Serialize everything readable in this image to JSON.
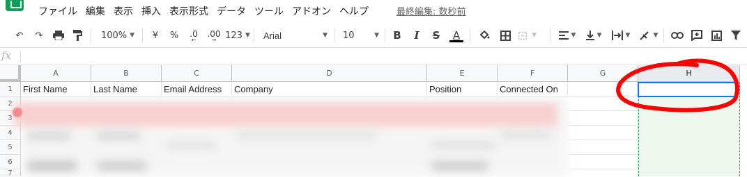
{
  "menubar": {
    "items": [
      "ファイル",
      "編集",
      "表示",
      "挿入",
      "表示形式",
      "データ",
      "ツール",
      "アドオン",
      "ヘルプ"
    ],
    "last_edit": "最終編集: 数秒前"
  },
  "toolbar": {
    "zoom": "100%",
    "currency": "¥",
    "percent": "%",
    "decrease_decimal": ".0",
    "increase_decimal": ".00",
    "number_format": "123",
    "font": "Arial",
    "font_size": "10",
    "bold": "B",
    "italic": "I",
    "strike": "S",
    "text_color": "A"
  },
  "formula_bar": {
    "label": "fx",
    "value": ""
  },
  "columns": [
    "A",
    "B",
    "C",
    "D",
    "E",
    "F",
    "G",
    "H"
  ],
  "rows": [
    "1",
    "2",
    "3",
    "4",
    "5",
    "6",
    "7"
  ],
  "header_row": [
    "First Name",
    "Last Name",
    "Email Address",
    "Company",
    "Position",
    "Connected On",
    "",
    ""
  ],
  "annotation": {
    "color": "#ff0000",
    "target_column": "H"
  },
  "colors": {
    "accent": "#1a73e8",
    "sheets_green": "#0f9d58",
    "selection_fill": "#eef7ee"
  }
}
